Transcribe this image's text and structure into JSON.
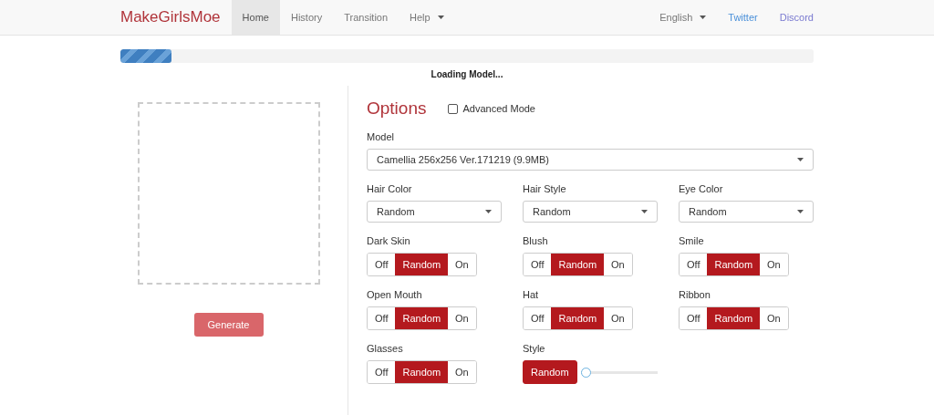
{
  "navbar": {
    "brand": "MakeGirlsMoe",
    "items": [
      {
        "label": "Home",
        "selected": true,
        "dropdown": false
      },
      {
        "label": "History",
        "selected": false,
        "dropdown": false
      },
      {
        "label": "Transition",
        "selected": false,
        "dropdown": false
      },
      {
        "label": "Help",
        "selected": false,
        "dropdown": true
      }
    ],
    "language": "English",
    "links": [
      "Twitter",
      "Discord"
    ]
  },
  "progress": {
    "level": 0.074,
    "label": "Loading Model..."
  },
  "generate_button": "Generate",
  "options": {
    "title": "Options",
    "advanced_mode": {
      "label": "Advanced Mode",
      "checked": false
    },
    "model": {
      "label": "Model",
      "value": "Camellia 256x256 Ver.171219 (9.9MB)"
    },
    "fields": [
      {
        "kind": "select",
        "label": "Hair Color",
        "value": "Random"
      },
      {
        "kind": "select",
        "label": "Hair Style",
        "value": "Random"
      },
      {
        "kind": "select",
        "label": "Eye Color",
        "value": "Random"
      },
      {
        "kind": "toggle",
        "label": "Dark Skin",
        "choices": [
          {
            "label": "Off",
            "selected": false
          },
          {
            "label": "Random",
            "selected": true
          },
          {
            "label": "On",
            "selected": false
          }
        ]
      },
      {
        "kind": "toggle",
        "label": "Blush",
        "choices": [
          {
            "label": "Off",
            "selected": false
          },
          {
            "label": "Random",
            "selected": true
          },
          {
            "label": "On",
            "selected": false
          }
        ]
      },
      {
        "kind": "toggle",
        "label": "Smile",
        "choices": [
          {
            "label": "Off",
            "selected": false
          },
          {
            "label": "Random",
            "selected": true
          },
          {
            "label": "On",
            "selected": false
          }
        ]
      },
      {
        "kind": "toggle",
        "label": "Open Mouth",
        "choices": [
          {
            "label": "Off",
            "selected": false
          },
          {
            "label": "Random",
            "selected": true
          },
          {
            "label": "On",
            "selected": false
          }
        ]
      },
      {
        "kind": "toggle",
        "label": "Hat",
        "choices": [
          {
            "label": "Off",
            "selected": false
          },
          {
            "label": "Random",
            "selected": true
          },
          {
            "label": "On",
            "selected": false
          }
        ]
      },
      {
        "kind": "toggle",
        "label": "Ribbon",
        "choices": [
          {
            "label": "Off",
            "selected": false
          },
          {
            "label": "Random",
            "selected": true
          },
          {
            "label": "On",
            "selected": false
          }
        ]
      },
      {
        "kind": "toggle",
        "label": "Glasses",
        "choices": [
          {
            "label": "Off",
            "selected": false
          },
          {
            "label": "Random",
            "selected": true
          },
          {
            "label": "On",
            "selected": false
          }
        ]
      },
      {
        "kind": "slider",
        "label": "Style",
        "button": {
          "label": "Random",
          "selected": true
        },
        "level": 0
      }
    ]
  }
}
